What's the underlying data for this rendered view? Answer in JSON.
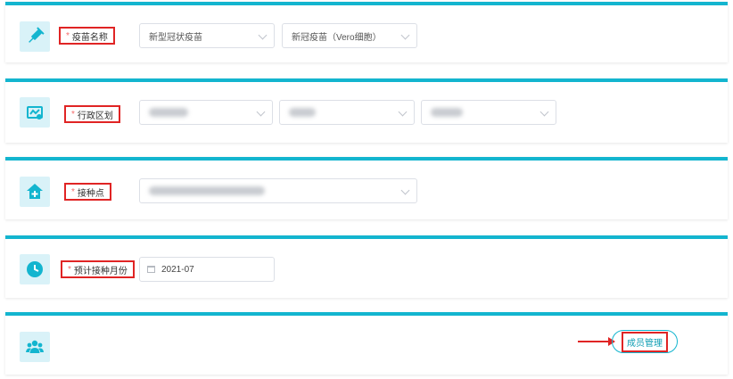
{
  "sections": {
    "vaccine": {
      "label": "疫苗名称",
      "required_mark": "*",
      "icon": "syringe-icon",
      "select_1": "新型冠状疫苗",
      "select_2": "新冠疫苗（Vero细胞）"
    },
    "region": {
      "label": "行政区划",
      "required_mark": "*",
      "icon": "map-icon"
    },
    "site": {
      "label": "接种点",
      "required_mark": "*",
      "icon": "clinic-icon"
    },
    "month": {
      "label": "预计接种月份",
      "required_mark": "*",
      "icon": "clock-icon",
      "value": "2021-07"
    },
    "members": {
      "icon": "users-icon",
      "button_label": "成员管理"
    }
  },
  "colors": {
    "accent": "#13b5cf",
    "highlight": "#e02424",
    "icon_bg": "#d9f2f8",
    "icon_fg": "#13b5cf"
  }
}
